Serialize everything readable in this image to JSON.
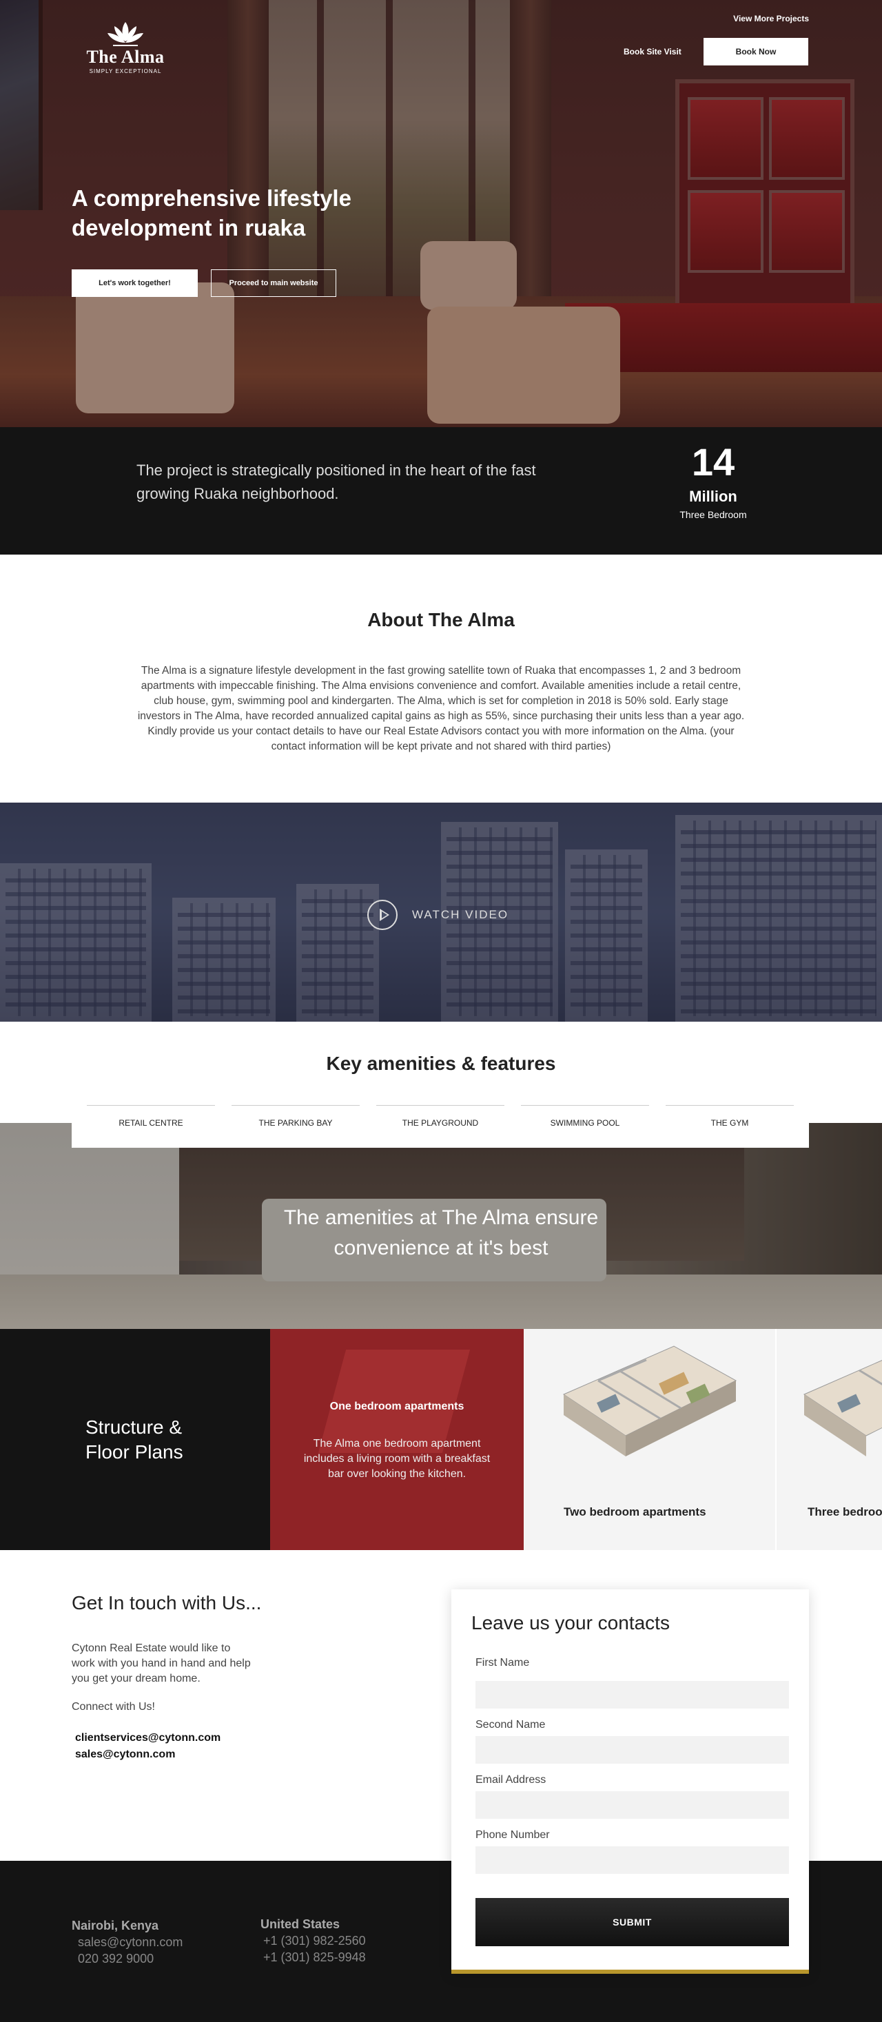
{
  "header": {
    "logo_name": "The Alma",
    "logo_tagline": "SIMPLY EXCEPTIONAL",
    "view_more": "View More Projects",
    "book_visit": "Book Site Visit",
    "book_now": "Book Now"
  },
  "hero": {
    "title": "A comprehensive lifestyle development in ruaka",
    "primary_button": "Let's work together!",
    "secondary_button": "Proceed to main website"
  },
  "stats": {
    "text": "The project is strategically positioned in the heart of the fast growing Ruaka neighborhood.",
    "number": "14",
    "unit": "Million",
    "sub": "Three Bedroom"
  },
  "about": {
    "title": "About The Alma",
    "text": "The Alma is a signature lifestyle development in the fast growing satellite town of Ruaka that encompasses 1, 2 and 3 bedroom apartments with impeccable finishing. The Alma envisions convenience and comfort. Available amenities include a retail centre, club house, gym, swimming pool and kindergarten. The Alma, which is set for completion in 2018 is 50% sold. Early stage investors in The Alma, have recorded annualized capital gains as high as 55%, since purchasing their units less than a year ago. Kindly provide us your contact details to have our Real Estate Advisors contact you with more information on the Alma. (your contact information will be kept private and not shared with third parties)"
  },
  "video": {
    "label": "WATCH VIDEO"
  },
  "amenities": {
    "title": "Key amenities & features",
    "tabs": [
      "RETAIL CENTRE",
      "THE PARKING BAY",
      "THE PLAYGROUND",
      "SWIMMING POOL",
      "THE GYM"
    ],
    "caption": "The amenities at The Alma ensure convenience at it's best"
  },
  "floor_plans": {
    "title": "Structure & Floor Plans",
    "active": {
      "title": "One bedroom apartments",
      "description": "The Alma one bedroom apartment includes a living room with a breakfast bar over looking the kitchen."
    },
    "cards": [
      "Two bedroom apartments",
      "Three bedroom apartments"
    ]
  },
  "contact": {
    "title": "Get In touch with Us...",
    "text": "Cytonn Real Estate would like to work with you hand in hand and help you get your dream home.",
    "connect": "Connect with Us!",
    "email1": "clientservices@cytonn.com",
    "email2": "sales@cytonn.com"
  },
  "form": {
    "title": "Leave us your contacts",
    "first_name": "First Name",
    "second_name": "Second Name",
    "email": "Email Address",
    "phone": "Phone Number",
    "submit": "SUBMIT"
  },
  "footer": {
    "kenya_title": "Nairobi, Kenya",
    "kenya_email": "sales@cytonn.com",
    "kenya_phone": "020 392 9000",
    "us_title": "United States",
    "us_phone1": "+1 (301) 982-2560",
    "us_phone2": "+1 (301) 825-9948"
  },
  "colors": {
    "accent_red": "#8f2326",
    "dark": "#141414",
    "gold": "#b8962c"
  }
}
